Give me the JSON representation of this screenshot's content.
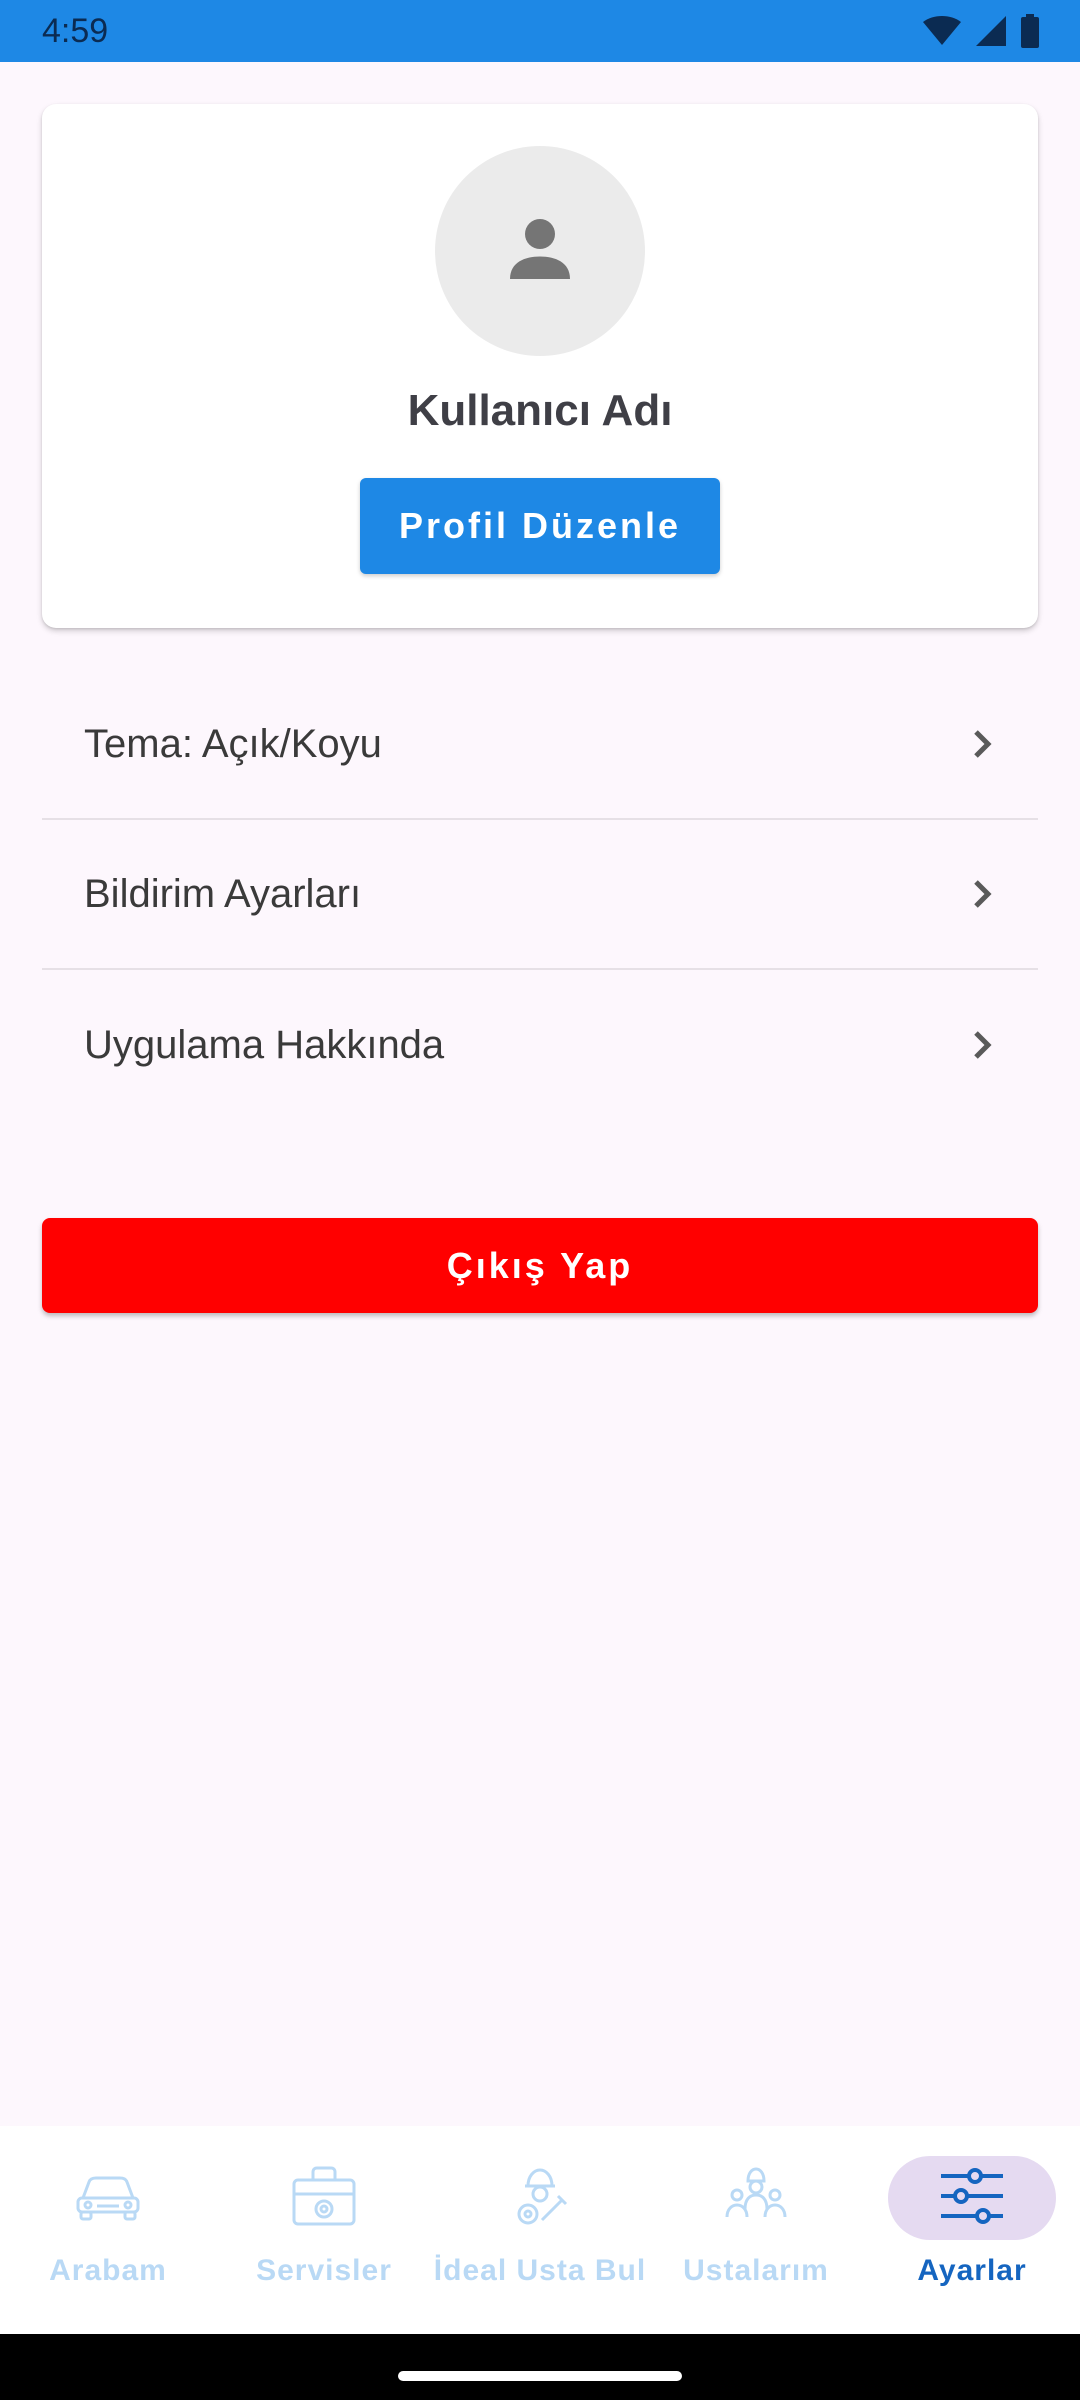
{
  "status_bar": {
    "time": "4:59",
    "icons": [
      "wifi-icon",
      "signal-icon",
      "battery-icon"
    ],
    "background": "#1E88E5"
  },
  "profile": {
    "avatar_icon": "person-icon",
    "username": "Kullanıcı Adı",
    "edit_button_label": "Profil Düzenle"
  },
  "settings": {
    "items": [
      {
        "label": "Tema: Açık/Koyu"
      },
      {
        "label": "Bildirim Ayarları"
      },
      {
        "label": "Uygulama Hakkında"
      }
    ]
  },
  "logout_label": "Çıkış Yap",
  "bottom_nav": {
    "items": [
      {
        "label": "Arabam",
        "icon": "car-icon",
        "active": false
      },
      {
        "label": "Servisler",
        "icon": "toolbox-icon",
        "active": false
      },
      {
        "label": "İdeal Usta Bul",
        "icon": "mechanic-icon",
        "active": false
      },
      {
        "label": "Ustalarım",
        "icon": "workers-icon",
        "active": false
      },
      {
        "label": "Ayarlar",
        "icon": "sliders-icon",
        "active": true
      }
    ]
  },
  "colors": {
    "primary": "#1E88E5",
    "danger": "#FF0000",
    "nav_active": "#1565C0",
    "nav_inactive": "#B9D9F5",
    "nav_active_pill": "#E5DAF1",
    "background": "#FDF7FD"
  }
}
